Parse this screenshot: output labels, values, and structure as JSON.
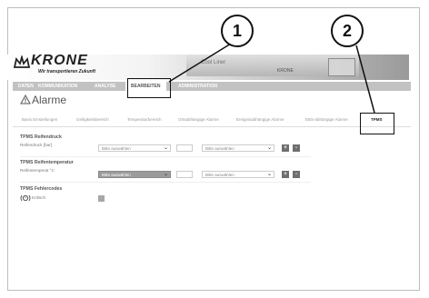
{
  "brand": {
    "logo_text": "KRONE",
    "tagline": "Wir transportieren Zukunft",
    "banner_text1": "Cool Liner",
    "banner_text2": "KRONE"
  },
  "nav": {
    "items": [
      {
        "label": "DATEN"
      },
      {
        "label": "KOMMUNIKATION"
      },
      {
        "label": "ANALYSE"
      },
      {
        "label": "BEARBEITEN"
      },
      {
        "label": "ADMINISTRATION"
      }
    ]
  },
  "page": {
    "title": "Alarme"
  },
  "tabs": [
    {
      "label": "Basis Einstellungen"
    },
    {
      "label": "Geltigkeitsbereich"
    },
    {
      "label": "Temperaturbereich"
    },
    {
      "label": "Ortsabhängige Alarme"
    },
    {
      "label": "Ereignisabhängige Alarme"
    },
    {
      "label": "EBS-abhängige Alarme"
    },
    {
      "label": "TPMS"
    }
  ],
  "sections": {
    "reifendruck": {
      "title": "TPMS Reifendruck",
      "label": "Reifendruck [bar]",
      "select1": "Bitte auswählen",
      "select2": "Bitte auswählen"
    },
    "reifentemp": {
      "title": "TPMS Reifentemperatur",
      "label": "Reifentemperat °C",
      "select1": "Bitte auswählen",
      "select2": "Bitte auswählen"
    },
    "fehlercodes": {
      "title": "TPMS Fehlercodes",
      "label": "Kritisch"
    }
  },
  "buttons": {
    "plus": "+",
    "minus": "-"
  },
  "callouts": [
    {
      "label": "1"
    },
    {
      "label": "2"
    }
  ]
}
